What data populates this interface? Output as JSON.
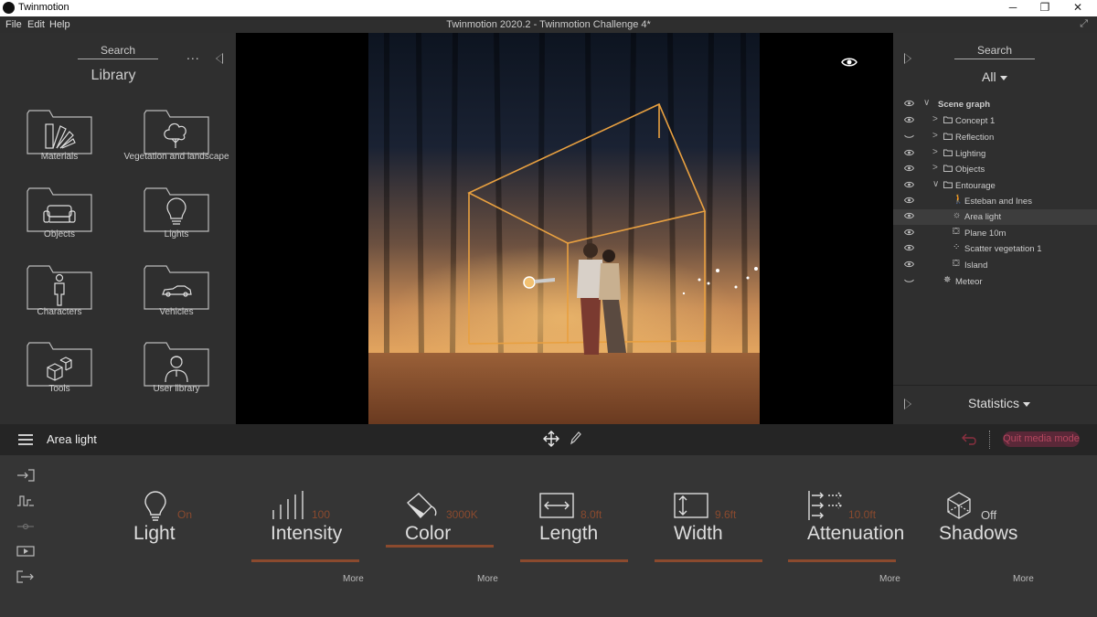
{
  "titlebar": {
    "app_name": "Twinmotion",
    "minimize": "─",
    "maximize": "❐",
    "close": "✕"
  },
  "menubar": {
    "file": "File",
    "edit": "Edit",
    "help": "Help",
    "document_title": "Twinmotion 2020.2 - Twinmotion Challenge 4*",
    "fullscreen": "⤢"
  },
  "library": {
    "search_label": "Search",
    "more": "...",
    "title": "Library",
    "folders": [
      {
        "label": "Materials",
        "icon": "fan-deck-icon"
      },
      {
        "label": "Vegetation and landscape",
        "icon": "tree-icon"
      },
      {
        "label": "Objects",
        "icon": "sofa-icon"
      },
      {
        "label": "Lights",
        "icon": "bulb-icon"
      },
      {
        "label": "Characters",
        "icon": "person-icon"
      },
      {
        "label": "Vehicles",
        "icon": "car-icon"
      },
      {
        "label": "Tools",
        "icon": "cubes-icon"
      },
      {
        "label": "User library",
        "icon": "user-icon"
      }
    ]
  },
  "scene_graph": {
    "search_label": "Search",
    "filter": "All",
    "items": [
      {
        "label": "Scene graph",
        "level": 0,
        "expanded": true,
        "visible": true
      },
      {
        "label": "Concept 1",
        "level": 1,
        "expanded": false,
        "visible": true,
        "icon": "folder-icon"
      },
      {
        "label": "Reflection",
        "level": 1,
        "expanded": false,
        "visible": false,
        "icon": "folder-icon"
      },
      {
        "label": "Lighting",
        "level": 1,
        "expanded": false,
        "visible": true,
        "icon": "folder-icon"
      },
      {
        "label": "Objects",
        "level": 1,
        "expanded": false,
        "visible": true,
        "icon": "folder-icon"
      },
      {
        "label": "Entourage",
        "level": 1,
        "expanded": true,
        "visible": true,
        "icon": "folder-icon"
      },
      {
        "label": "Esteban and Ines",
        "level": 2,
        "visible": true,
        "icon": "walking-person-icon"
      },
      {
        "label": "Area light",
        "level": 2,
        "visible": true,
        "icon": "light-icon",
        "selected": true
      },
      {
        "label": "Plane 10m",
        "level": 2,
        "visible": true,
        "icon": "object-icon"
      },
      {
        "label": "Scatter vegetation 1",
        "level": 2,
        "visible": true,
        "icon": "scatter-icon"
      },
      {
        "label": "Island",
        "level": 2,
        "visible": true,
        "icon": "object-icon"
      },
      {
        "label": "Meteor",
        "level": 1,
        "visible": false,
        "icon": "meteor-icon"
      }
    ],
    "statistics": "Statistics"
  },
  "toolbar": {
    "title": "Area light",
    "quit_media_mode": "Quit media mode"
  },
  "properties": {
    "light": {
      "label": "Light",
      "value": "On"
    },
    "intensity": {
      "label": "Intensity",
      "value": "100"
    },
    "color": {
      "label": "Color",
      "value": "3000K"
    },
    "length": {
      "label": "Length",
      "value": "8.0ft"
    },
    "width": {
      "label": "Width",
      "value": "9.6ft"
    },
    "attenuation": {
      "label": "Attenuation",
      "value": "10.0ft"
    },
    "shadows": {
      "label": "Shadows",
      "value": "Off"
    },
    "more": "More"
  },
  "colors": {
    "accent": "#8b4a2e",
    "selection": "#3d3d3d",
    "quit_bg": "#5a2838",
    "quit_text": "#b5475f",
    "light_frame": "#e8a040"
  }
}
